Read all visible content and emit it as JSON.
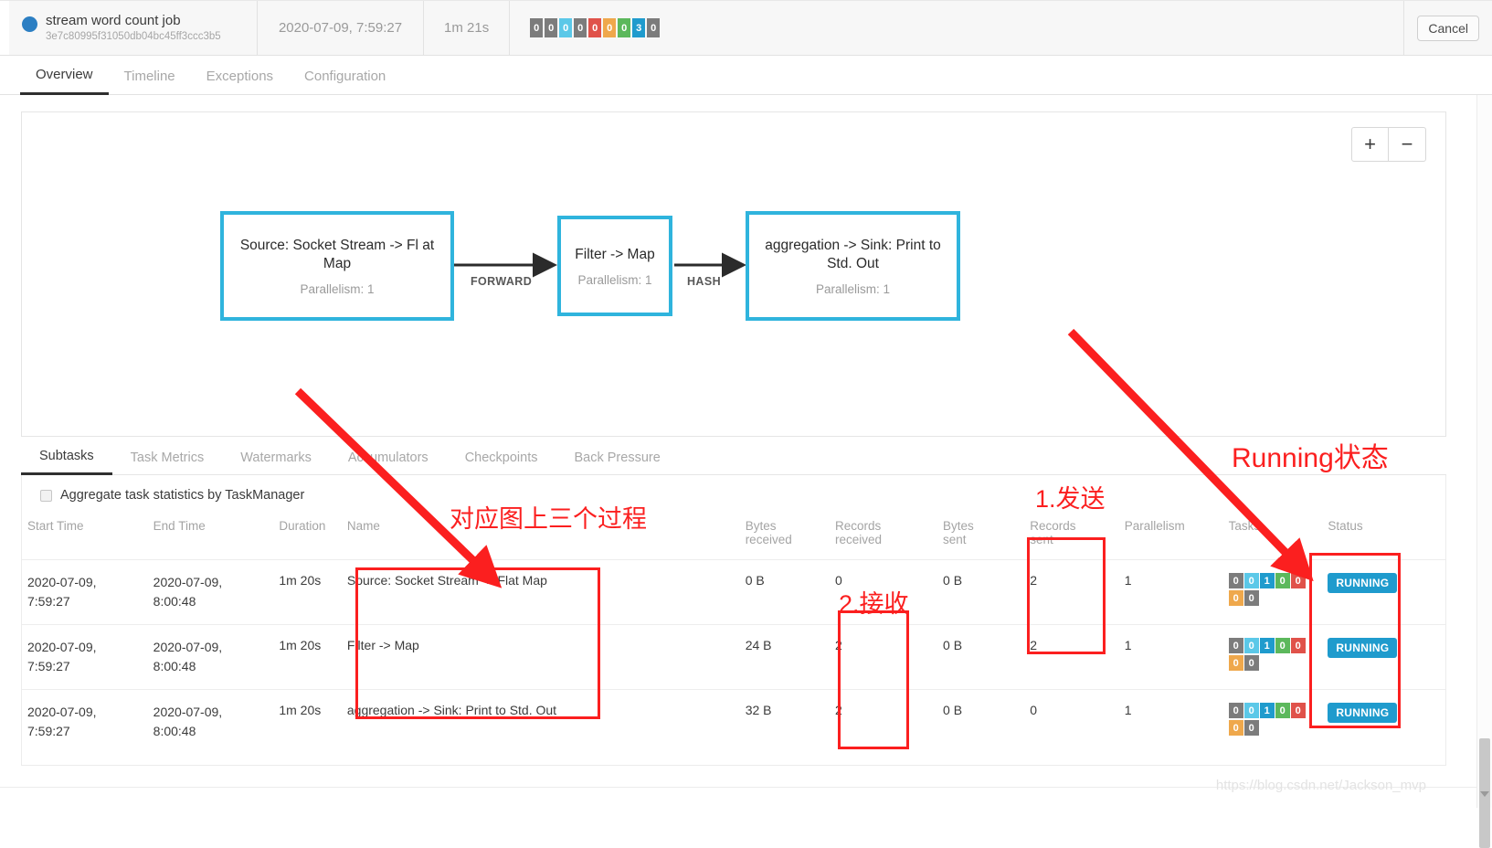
{
  "header": {
    "job_name": "stream word count job",
    "job_id": "3e7c80995f31050db04bc45ff3ccc3b5",
    "start_time": "2020-07-09, 7:59:27",
    "duration": "1m 21s",
    "cancel_label": "Cancel",
    "status_badges": [
      {
        "value": "0",
        "color": "#7c7c7c"
      },
      {
        "value": "0",
        "color": "#7c7c7c"
      },
      {
        "value": "0",
        "color": "#5bc8e8"
      },
      {
        "value": "0",
        "color": "#7c7c7c"
      },
      {
        "value": "0",
        "color": "#e0524a"
      },
      {
        "value": "0",
        "color": "#efa84c"
      },
      {
        "value": "0",
        "color": "#5cb85c"
      },
      {
        "value": "3",
        "color": "#1f9bcd"
      },
      {
        "value": "0",
        "color": "#7c7c7c"
      }
    ]
  },
  "nav_tabs": [
    {
      "label": "Overview",
      "active": true
    },
    {
      "label": "Timeline",
      "active": false
    },
    {
      "label": "Exceptions",
      "active": false
    },
    {
      "label": "Configuration",
      "active": false
    }
  ],
  "graph": {
    "zoom_in": "+",
    "zoom_out": "−",
    "accent_color": "#2fb4dd",
    "nodes": [
      {
        "name": "Source: Socket Stream -> Fl at Map",
        "parallelism": "Parallelism: 1"
      },
      {
        "name": "Filter -> Map",
        "parallelism": "Parallelism: 1"
      },
      {
        "name": "aggregation -> Sink: Print to Std. Out",
        "parallelism": "Parallelism: 1"
      }
    ],
    "edges": [
      {
        "label": "FORWARD"
      },
      {
        "label": "HASH"
      }
    ]
  },
  "sub_tabs": [
    {
      "label": "Subtasks",
      "active": true
    },
    {
      "label": "Task Metrics",
      "active": false
    },
    {
      "label": "Watermarks",
      "active": false
    },
    {
      "label": "Accumulators",
      "active": false
    },
    {
      "label": "Checkpoints",
      "active": false
    },
    {
      "label": "Back Pressure",
      "active": false
    }
  ],
  "table": {
    "aggregate_label": "Aggregate task statistics by TaskManager",
    "columns": [
      "Start Time",
      "End Time",
      "Duration",
      "Name",
      "Bytes received",
      "Records received",
      "Bytes sent",
      "Records sent",
      "Parallelism",
      "Tasks",
      "Status"
    ],
    "rows": [
      {
        "start_time": "2020-07-09, 7:59:27",
        "end_time": "2020-07-09, 8:00:48",
        "duration": "1m 20s",
        "name": "Source: Socket Stream -> Flat Map",
        "bytes_received": "0 B",
        "records_received": "0",
        "bytes_sent": "0 B",
        "records_sent": "2",
        "parallelism": "1",
        "tasks": [
          {
            "value": "0",
            "color": "#7c7c7c"
          },
          {
            "value": "0",
            "color": "#5bc8e8"
          },
          {
            "value": "1",
            "color": "#1f9bcd"
          },
          {
            "value": "0",
            "color": "#5cb85c"
          },
          {
            "value": "0",
            "color": "#e0524a"
          },
          {
            "value": "0",
            "color": "#efa84c"
          },
          {
            "value": "0",
            "color": "#7c7c7c"
          }
        ],
        "status": "RUNNING"
      },
      {
        "start_time": "2020-07-09, 7:59:27",
        "end_time": "2020-07-09, 8:00:48",
        "duration": "1m 20s",
        "name": "Filter -> Map",
        "bytes_received": "24 B",
        "records_received": "2",
        "bytes_sent": "0 B",
        "records_sent": "2",
        "parallelism": "1",
        "tasks": [
          {
            "value": "0",
            "color": "#7c7c7c"
          },
          {
            "value": "0",
            "color": "#5bc8e8"
          },
          {
            "value": "1",
            "color": "#1f9bcd"
          },
          {
            "value": "0",
            "color": "#5cb85c"
          },
          {
            "value": "0",
            "color": "#e0524a"
          },
          {
            "value": "0",
            "color": "#efa84c"
          },
          {
            "value": "0",
            "color": "#7c7c7c"
          }
        ],
        "status": "RUNNING"
      },
      {
        "start_time": "2020-07-09, 7:59:27",
        "end_time": "2020-07-09, 8:00:48",
        "duration": "1m 20s",
        "name": "aggregation -> Sink: Print to Std. Out",
        "bytes_received": "32 B",
        "records_received": "2",
        "bytes_sent": "0 B",
        "records_sent": "0",
        "parallelism": "1",
        "tasks": [
          {
            "value": "0",
            "color": "#7c7c7c"
          },
          {
            "value": "0",
            "color": "#5bc8e8"
          },
          {
            "value": "1",
            "color": "#1f9bcd"
          },
          {
            "value": "0",
            "color": "#5cb85c"
          },
          {
            "value": "0",
            "color": "#e0524a"
          },
          {
            "value": "0",
            "color": "#efa84c"
          },
          {
            "value": "0",
            "color": "#7c7c7c"
          }
        ],
        "status": "RUNNING"
      }
    ]
  },
  "annotations": {
    "color": "#fb1f1f",
    "running_status": "Running状态",
    "three_processes": "对应图上三个过程",
    "send": "1.发送",
    "receive": "2.接收"
  },
  "watermark": "https://blog.csdn.net/Jackson_mvp"
}
